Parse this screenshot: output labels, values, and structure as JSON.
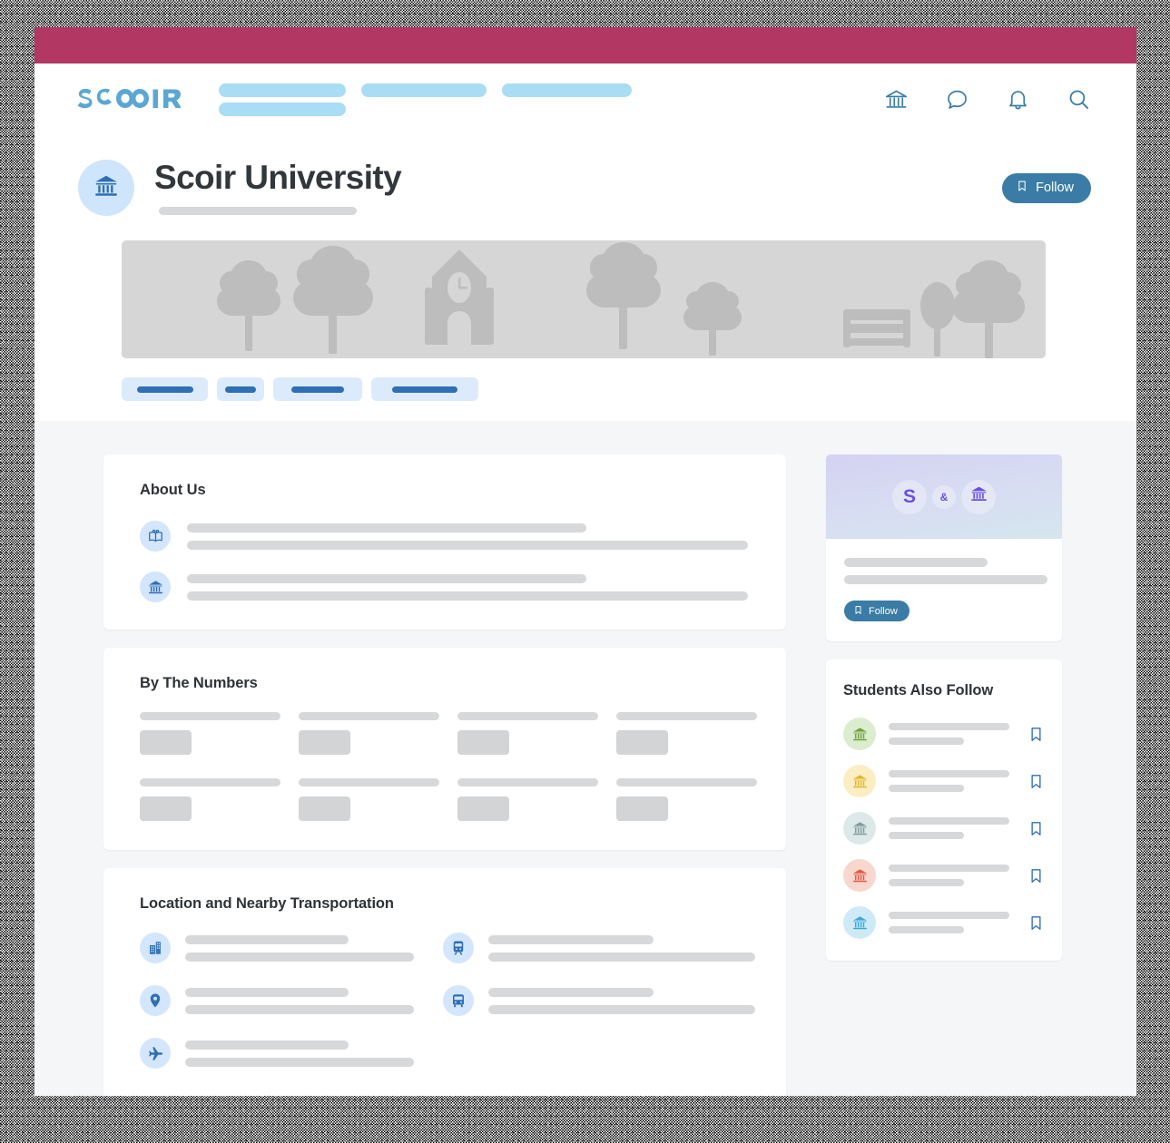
{
  "theme": {
    "accent_bar_color": "#b23763",
    "brand_blue": "#5ba7d4",
    "icon_blue": "#3a7ca5",
    "link_blue": "#2f6fb5",
    "page_background": "#f5f6f8",
    "skeleton_gray": "#d7d8da",
    "partner_purple": "#6c4ee0"
  },
  "header": {
    "logo_text": "SCOIR",
    "logo_icon": "scoir-wordmark-logo",
    "nav_placeholders": [
      {
        "name": "nav-item-1",
        "lines": 2
      },
      {
        "name": "nav-item-2",
        "lines": 1
      },
      {
        "name": "nav-item-3",
        "lines": 1
      }
    ],
    "icons": [
      {
        "name": "college-bank-icon",
        "label": "Colleges"
      },
      {
        "name": "chat-bubble-icon",
        "label": "Messages"
      },
      {
        "name": "bell-icon",
        "label": "Notifications"
      },
      {
        "name": "search-icon",
        "label": "Search"
      }
    ]
  },
  "profile": {
    "avatar_icon": "bank-icon",
    "name": "Scoir University",
    "subtitle_placeholder": "",
    "follow_label": "Follow",
    "follow_icon": "bookmark-icon",
    "banner_icon": "campus-illustration-placeholder",
    "tabs": [
      {
        "name": "tab-1"
      },
      {
        "name": "tab-2"
      },
      {
        "name": "tab-3"
      },
      {
        "name": "tab-4"
      }
    ]
  },
  "about": {
    "title": "About Us",
    "rows": [
      {
        "icon": "book-icon",
        "lines": 2
      },
      {
        "icon": "bank-icon",
        "lines": 2
      }
    ]
  },
  "numbers": {
    "title": "By The Numbers",
    "stats": [
      {
        "name": "stat-1"
      },
      {
        "name": "stat-2"
      },
      {
        "name": "stat-3"
      },
      {
        "name": "stat-4"
      },
      {
        "name": "stat-5"
      },
      {
        "name": "stat-6"
      },
      {
        "name": "stat-7"
      },
      {
        "name": "stat-8"
      }
    ]
  },
  "location": {
    "title": "Location and Nearby Transportation",
    "rows": [
      {
        "icon": "city-building-icon",
        "column": "left"
      },
      {
        "icon": "train-icon",
        "column": "right"
      },
      {
        "icon": "map-pin-icon",
        "column": "left"
      },
      {
        "icon": "bus-icon",
        "column": "right"
      },
      {
        "icon": "airplane-icon",
        "column": "left"
      }
    ]
  },
  "partner_card": {
    "left_initial": "S",
    "ampersand": "&",
    "right_icon": "bank-icon",
    "follow_label": "Follow",
    "follow_icon": "bookmark-icon"
  },
  "students_also_follow": {
    "title": "Students Also Follow",
    "rows": [
      {
        "name": "also-row-1",
        "avatar_icon": "bank-icon",
        "avatar_bg": "#dcedcf",
        "avatar_fg": "#6fa439",
        "bookmark_icon": "bookmark-icon"
      },
      {
        "name": "also-row-2",
        "avatar_icon": "bank-icon",
        "avatar_bg": "#fbeec2",
        "avatar_fg": "#e2b62c",
        "bookmark_icon": "bookmark-icon"
      },
      {
        "name": "also-row-3",
        "avatar_icon": "bank-icon",
        "avatar_bg": "#dde8e8",
        "avatar_fg": "#7e9a9d",
        "bookmark_icon": "bookmark-icon"
      },
      {
        "name": "also-row-4",
        "avatar_icon": "bank-icon",
        "avatar_bg": "#f8d7ce",
        "avatar_fg": "#e0584a",
        "bookmark_icon": "bookmark-icon"
      },
      {
        "name": "also-row-5",
        "avatar_icon": "bank-icon",
        "avatar_bg": "#cfeaf7",
        "avatar_fg": "#3aa8d6",
        "bookmark_icon": "bookmark-icon"
      }
    ]
  }
}
